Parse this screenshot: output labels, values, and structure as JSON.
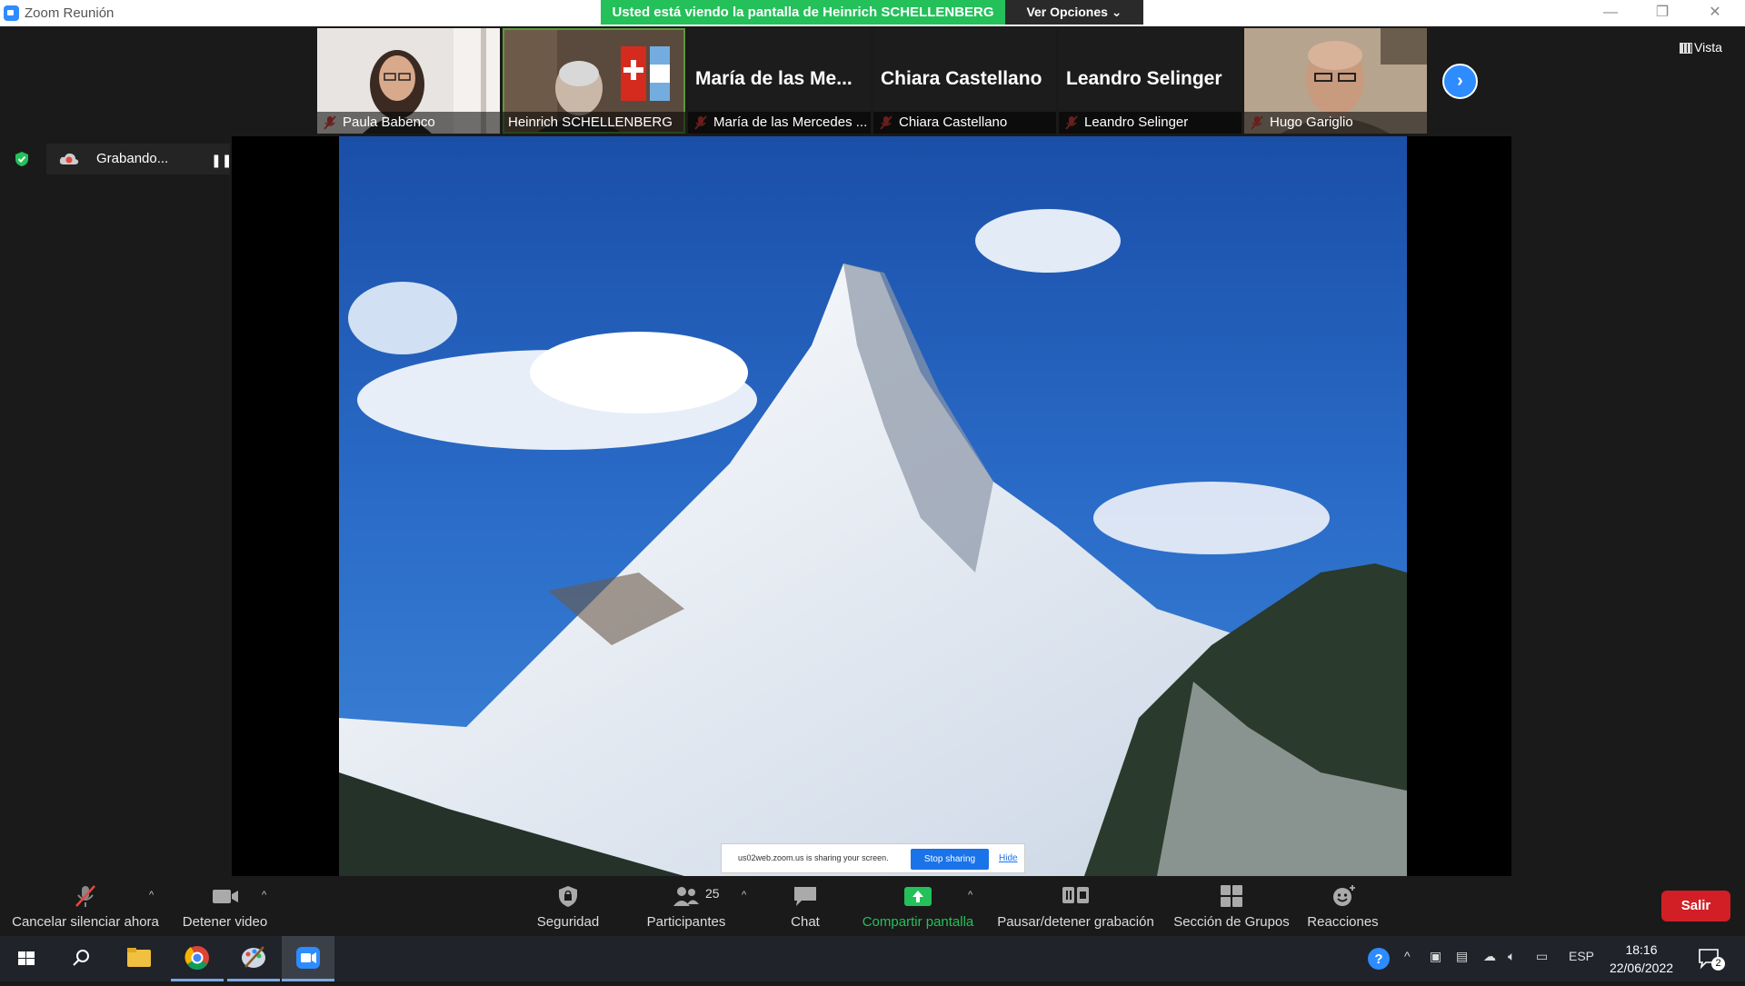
{
  "window": {
    "title": "Zoom Reunión",
    "share_notice": "Usted está viendo la pantalla de Heinrich SCHELLENBERG",
    "view_options_label": "Ver Opciones ⌄"
  },
  "participants": [
    {
      "name": "Paula Babenco",
      "video": true
    },
    {
      "name": "Heinrich SCHELLENBERG",
      "video": true,
      "active": true
    },
    {
      "name": "María de las Mercedes ...",
      "display_name": "María de las Me...",
      "video": false
    },
    {
      "name": "Chiara Castellano",
      "display_name": "Chiara Castellano",
      "video": false
    },
    {
      "name": "Leandro Selinger",
      "display_name": "Leandro Selinger",
      "video": false
    },
    {
      "name": "Hugo Gariglio",
      "video": true
    }
  ],
  "view_label": "Vista",
  "recording": {
    "label": "Grabando...",
    "pause_glyph": "❚❚"
  },
  "share_popup": {
    "text": "us02web.zoom.us is sharing your screen.",
    "stop_label": "Stop sharing",
    "hide_label": "Hide"
  },
  "toolbar": {
    "mute_label": "Cancelar silenciar ahora",
    "video_label": "Detener video",
    "security_label": "Seguridad",
    "participants_label": "Participantes",
    "participants_count": "25",
    "chat_label": "Chat",
    "share_label": "Compartir pantalla",
    "record_label": "Pausar/detener grabación",
    "rooms_label": "Sección de Grupos",
    "reactions_label": "Reacciones",
    "leave_label": "Salir"
  },
  "taskbar": {
    "language": "ESP",
    "time": "18:16",
    "date": "22/06/2022",
    "notification_count": "2"
  },
  "colors": {
    "zoom_blue": "#2d8cff",
    "share_green": "#24c05a",
    "leave_red": "#d21f26"
  }
}
